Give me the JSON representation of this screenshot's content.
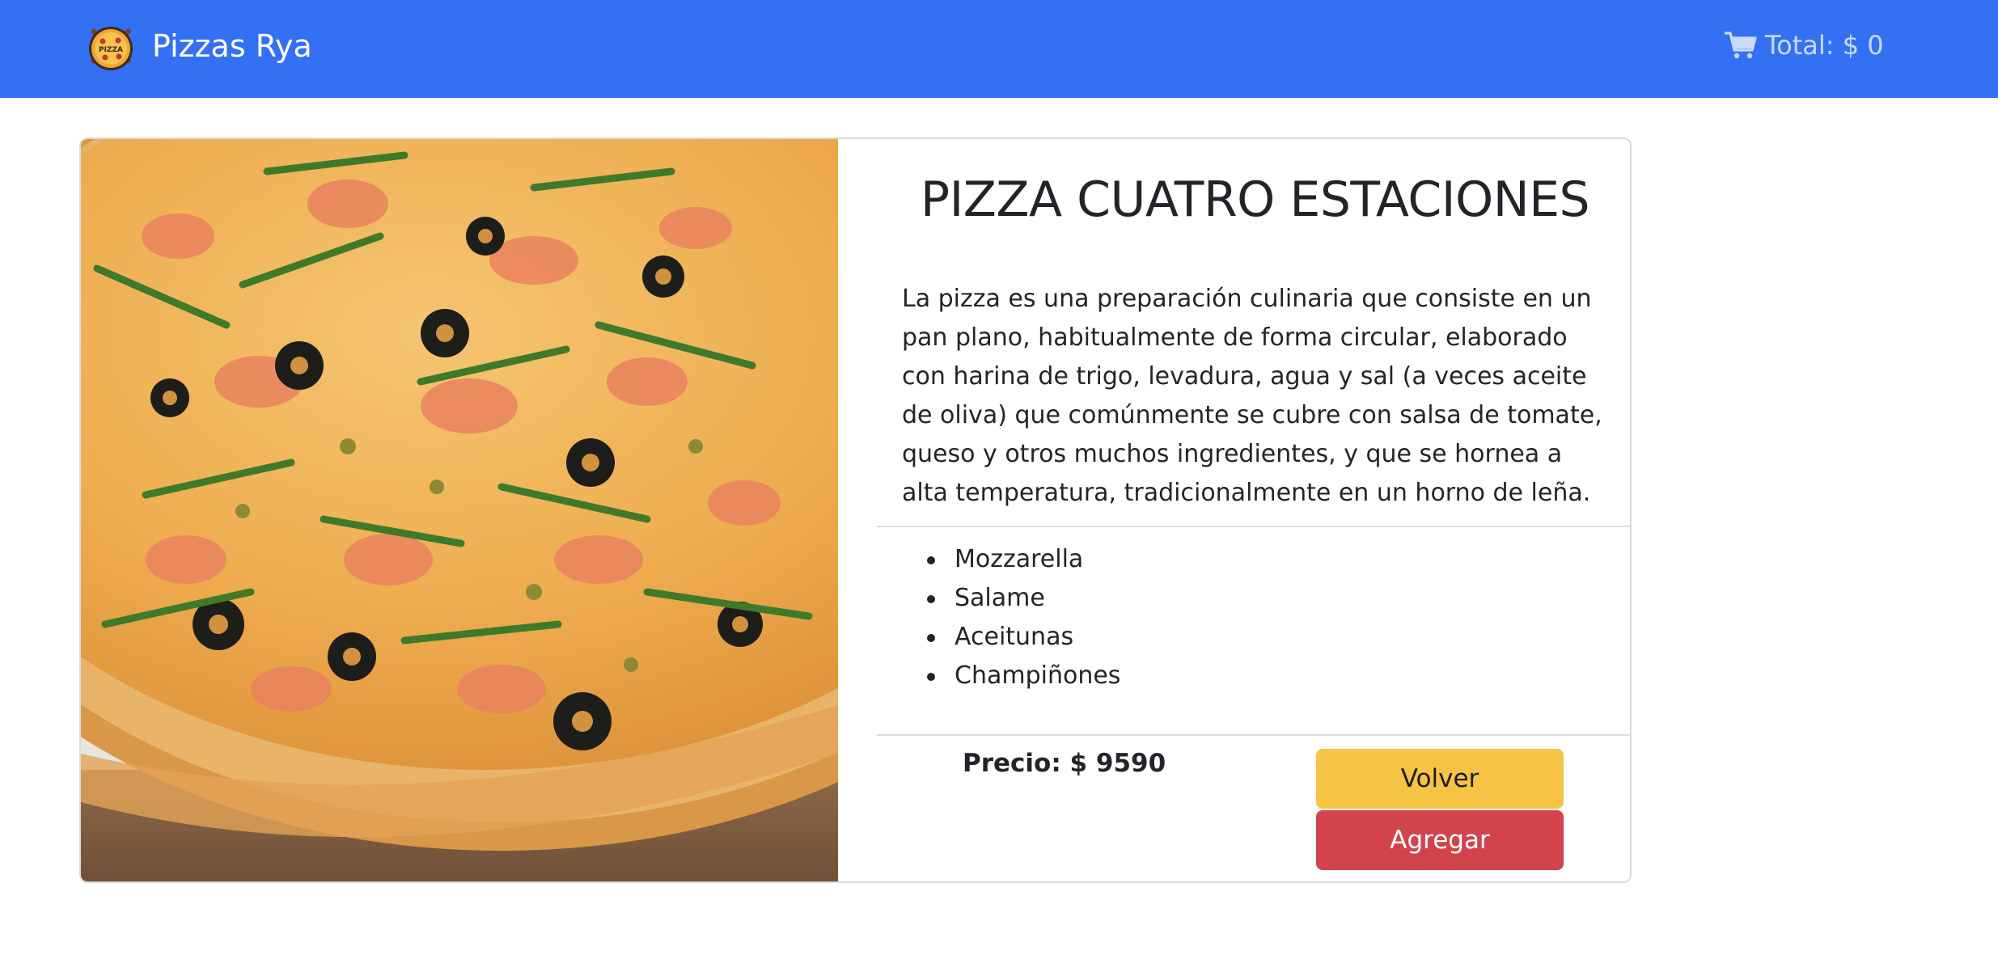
{
  "navbar": {
    "brand": "Pizzas Rya",
    "logo_icon": "pizza-logo-icon",
    "logo_text": "PIZZA",
    "cart_icon": "shopping-cart-icon",
    "cart_total": "Total: $ 0"
  },
  "product": {
    "name": "PIZZA CUATRO ESTACIONES",
    "description": "La pizza es una preparación culinaria que consiste en un pan plano, habitualmente de forma circular, elaborado con harina de trigo, levadura, agua y sal (a veces aceite de oliva) que comúnmente se cubre con salsa de tomate, queso y otros muchos ingredientes, y que se hornea a alta temperatura, tradicionalmente en un horno de leña.",
    "ingredients": [
      "Mozzarella",
      "Salame",
      "Aceitunas",
      "Champiñones"
    ],
    "price": "Precio: $ 9590"
  },
  "actions": {
    "back_label": "Volver",
    "add_label": "Agregar"
  },
  "colors": {
    "navbar": "#3470f4",
    "back_button": "#f6c344",
    "add_button": "#d2444c"
  }
}
